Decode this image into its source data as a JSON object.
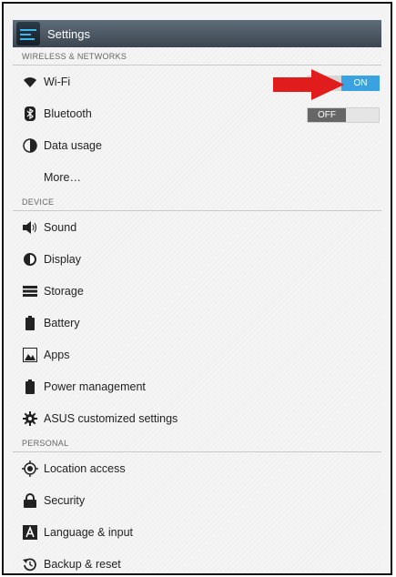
{
  "titlebar": {
    "title": "Settings"
  },
  "sections": {
    "wireless": "WIRELESS & NETWORKS",
    "device": "DEVICE",
    "personal": "PERSONAL"
  },
  "wireless_items": {
    "wifi": "Wi-Fi",
    "wifi_toggle": "ON",
    "bluetooth": "Bluetooth",
    "bluetooth_toggle": "OFF",
    "data_usage": "Data usage",
    "more": "More…"
  },
  "device_items": {
    "sound": "Sound",
    "display": "Display",
    "storage": "Storage",
    "battery": "Battery",
    "apps": "Apps",
    "power": "Power management",
    "asus": "ASUS customized settings"
  },
  "personal_items": {
    "location": "Location access",
    "security": "Security",
    "language": "Language & input",
    "backup": "Backup & reset"
  },
  "colors": {
    "accent": "#3aa2e0",
    "arrow": "#e01c1c"
  }
}
